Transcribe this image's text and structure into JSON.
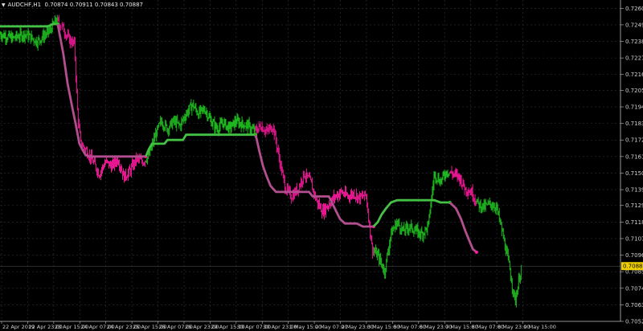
{
  "window": {
    "symbol_timeframe": "AUDCHF,H1",
    "ohlc": "0.70874 0.70911 0.70843 0.70887",
    "collapse_icon": "triangle-down-icon"
  },
  "colors": {
    "background": "#000000",
    "grid": "#2a3540",
    "axis": "#c0c0c0",
    "text": "#d0d0d0",
    "up": "#22cc22",
    "down": "#ff1aa0",
    "line_up": "#44c044",
    "line_down": "#b44f8f",
    "price_marker_bg": "#f0d000"
  },
  "current_price": "0.70887",
  "chart_data": {
    "type": "line",
    "title": "",
    "xlabel": "",
    "ylabel": "",
    "ylim": [
      0.7052,
      0.72655
    ],
    "y_ticks": [
      0.726,
      0.7249,
      0.7238,
      0.7227,
      0.7216,
      0.72055,
      0.71945,
      0.71835,
      0.71725,
      0.71615,
      0.71505,
      0.71395,
      0.7129,
      0.7118,
      0.7107,
      0.7096,
      0.7085,
      0.7074,
      0.7063,
      0.7052
    ],
    "y_tick_labels": [
      "0.72600",
      "0.72490",
      "0.72380",
      "0.72270",
      "0.72160",
      "0.72055",
      "0.71945",
      "0.71835",
      "0.71725",
      "0.71615",
      "0.71505",
      "0.71395",
      "0.71290",
      "0.71180",
      "0.71070",
      "0.70960",
      "0.70850",
      "0.70740",
      "0.70630",
      "0.70520"
    ],
    "x_range": [
      0,
      100
    ],
    "x_ticks": [
      {
        "x": 0,
        "label": "22 Apr 2019"
      },
      {
        "x": 4.2,
        "label": "22 Apr 23:00"
      },
      {
        "x": 8.4,
        "label": "23 Apr 15:00"
      },
      {
        "x": 12.6,
        "label": "24 Apr 07:00"
      },
      {
        "x": 16.8,
        "label": "24 Apr 23:00"
      },
      {
        "x": 21.0,
        "label": "25 Apr 15:00"
      },
      {
        "x": 25.2,
        "label": "26 Apr 07:00"
      },
      {
        "x": 29.4,
        "label": "26 Apr 23:00"
      },
      {
        "x": 33.6,
        "label": "29 Apr 15:00"
      },
      {
        "x": 37.8,
        "label": "30 Apr 07:00"
      },
      {
        "x": 42.0,
        "label": "30 Apr 23:00"
      },
      {
        "x": 46.2,
        "label": "1 May 15:00"
      },
      {
        "x": 50.4,
        "label": "2 May 07:00"
      },
      {
        "x": 54.6,
        "label": "2 May 23:00"
      },
      {
        "x": 58.8,
        "label": "3 May 15:00"
      },
      {
        "x": 63.0,
        "label": "6 May 07:00"
      },
      {
        "x": 67.2,
        "label": "6 May 23:00"
      },
      {
        "x": 71.4,
        "label": "7 May 15:00"
      },
      {
        "x": 75.6,
        "label": "8 May 07:00"
      },
      {
        "x": 79.8,
        "label": "8 May 23:00"
      },
      {
        "x": 84.0,
        "label": "9 May 15:00"
      }
    ],
    "price_path": [
      [
        0,
        0.7243
      ],
      [
        2,
        0.724
      ],
      [
        4,
        0.7243
      ],
      [
        6,
        0.7238
      ],
      [
        8,
        0.7245
      ],
      [
        9,
        0.7252
      ],
      [
        10,
        0.7248
      ],
      [
        11,
        0.724
      ],
      [
        12,
        0.7236
      ],
      [
        12.5,
        0.719
      ],
      [
        13,
        0.717
      ],
      [
        14,
        0.7165
      ],
      [
        15,
        0.7158
      ],
      [
        16,
        0.715
      ],
      [
        17,
        0.7158
      ],
      [
        18,
        0.7155
      ],
      [
        19,
        0.716
      ],
      [
        20,
        0.7148
      ],
      [
        21,
        0.7152
      ],
      [
        22,
        0.716
      ],
      [
        23,
        0.7158
      ],
      [
        24,
        0.7162
      ],
      [
        25,
        0.7175
      ],
      [
        26,
        0.7185
      ],
      [
        27,
        0.718
      ],
      [
        28,
        0.7185
      ],
      [
        29,
        0.7182
      ],
      [
        30,
        0.719
      ],
      [
        31,
        0.7196
      ],
      [
        32,
        0.719
      ],
      [
        33,
        0.7193
      ],
      [
        34,
        0.7185
      ],
      [
        35,
        0.718
      ],
      [
        36,
        0.7184
      ],
      [
        37,
        0.718
      ],
      [
        38,
        0.7185
      ],
      [
        39,
        0.7183
      ],
      [
        40,
        0.7182
      ],
      [
        41,
        0.7178
      ],
      [
        42,
        0.7182
      ],
      [
        43,
        0.7178
      ],
      [
        44,
        0.7182
      ],
      [
        45,
        0.716
      ],
      [
        46,
        0.714
      ],
      [
        47,
        0.7135
      ],
      [
        48,
        0.714
      ],
      [
        49,
        0.715
      ],
      [
        50,
        0.7145
      ],
      [
        51,
        0.7132
      ],
      [
        52,
        0.7125
      ],
      [
        53,
        0.713
      ],
      [
        54,
        0.7135
      ],
      [
        55,
        0.7138
      ],
      [
        56,
        0.7135
      ],
      [
        57,
        0.7137
      ],
      [
        58,
        0.7134
      ],
      [
        59,
        0.7136
      ],
      [
        60,
        0.71
      ],
      [
        61,
        0.7095
      ],
      [
        62,
        0.7085
      ],
      [
        63,
        0.711
      ],
      [
        64,
        0.7118
      ],
      [
        65,
        0.7112
      ],
      [
        66,
        0.7115
      ],
      [
        67,
        0.7112
      ],
      [
        68,
        0.711
      ],
      [
        69,
        0.7115
      ],
      [
        70,
        0.715
      ],
      [
        71,
        0.7145
      ],
      [
        72,
        0.7152
      ],
      [
        73,
        0.715
      ],
      [
        74,
        0.7148
      ],
      [
        75,
        0.714
      ],
      [
        76,
        0.7138
      ],
      [
        77,
        0.713
      ],
      [
        78,
        0.7128
      ],
      [
        79,
        0.713
      ],
      [
        80,
        0.7128
      ],
      [
        81,
        0.711
      ],
      [
        82,
        0.709
      ],
      [
        83,
        0.7065
      ],
      [
        84,
        0.7088
      ]
    ],
    "series": [
      {
        "type": "step-line",
        "segments": [
          {
            "trend": "up",
            "points": [
              [
                0,
                0.7248
              ],
              [
                7.8,
                0.7248
              ],
              [
                8.5,
                0.72495
              ],
              [
                9.3,
                0.72495
              ]
            ]
          },
          {
            "trend": "down",
            "points": [
              [
                9.3,
                0.72495
              ],
              [
                10.2,
                0.723
              ],
              [
                10.9,
                0.721
              ],
              [
                11.6,
                0.7195
              ],
              [
                12.2,
                0.7183
              ],
              [
                12.8,
                0.717
              ],
              [
                13.3,
                0.7166
              ],
              [
                13.8,
                0.71625
              ],
              [
                14.5,
                0.71615
              ],
              [
                16.6,
                0.71615
              ],
              [
                23.5,
                0.71615
              ]
            ]
          },
          {
            "trend": "up",
            "points": [
              [
                23.5,
                0.71615
              ],
              [
                24.0,
                0.71665
              ],
              [
                24.5,
                0.717
              ],
              [
                26.5,
                0.717
              ],
              [
                27.0,
                0.71725
              ],
              [
                29.5,
                0.71725
              ],
              [
                30.0,
                0.7176
              ],
              [
                34.0,
                0.7176
              ],
              [
                41.2,
                0.7176
              ]
            ]
          },
          {
            "trend": "down",
            "points": [
              [
                41.2,
                0.7176
              ],
              [
                41.8,
                0.7165
              ],
              [
                42.4,
                0.7155
              ],
              [
                43.0,
                0.7148
              ],
              [
                43.6,
                0.7142
              ],
              [
                44.5,
                0.7138
              ],
              [
                45.5,
                0.7138
              ],
              [
                49.8,
                0.7138
              ],
              [
                50.4,
                0.7135
              ],
              [
                53.0,
                0.7135
              ],
              [
                53.6,
                0.713
              ],
              [
                54.2,
                0.7125
              ],
              [
                54.8,
                0.712
              ],
              [
                55.6,
                0.7117
              ],
              [
                57.5,
                0.7117
              ],
              [
                58.5,
                0.7115
              ],
              [
                60.2,
                0.7115
              ]
            ]
          },
          {
            "trend": "up",
            "points": [
              [
                60.2,
                0.7115
              ],
              [
                60.9,
                0.7118
              ],
              [
                61.5,
                0.7123
              ],
              [
                62.2,
                0.7127
              ],
              [
                63.0,
                0.7131
              ],
              [
                64.0,
                0.71325
              ],
              [
                70.0,
                0.71325
              ],
              [
                71.0,
                0.7131
              ],
              [
                72.5,
                0.7131
              ]
            ]
          },
          {
            "trend": "down",
            "points": [
              [
                72.5,
                0.7131
              ],
              [
                73.5,
                0.7127
              ],
              [
                74.3,
                0.712
              ],
              [
                75.0,
                0.7112
              ],
              [
                75.6,
                0.7106
              ],
              [
                76.2,
                0.71
              ],
              [
                76.8,
                0.7098
              ]
            ]
          }
        ]
      }
    ]
  }
}
